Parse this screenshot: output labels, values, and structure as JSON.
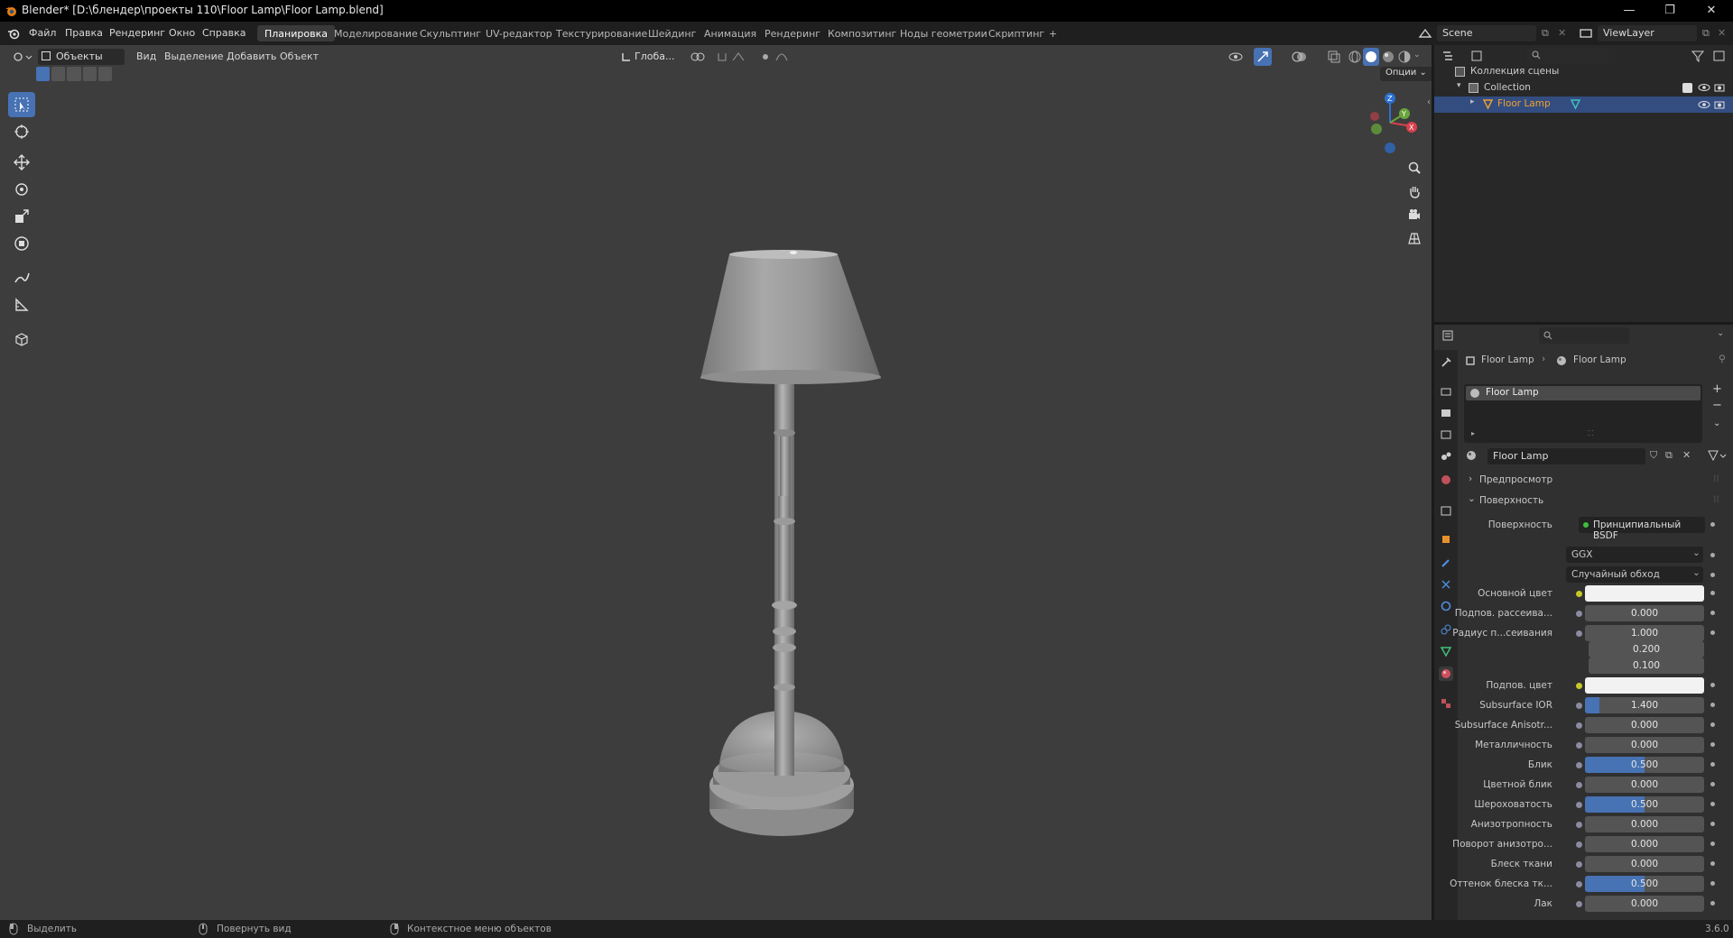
{
  "title": "Blender* [D:\\блендер\\проекты 110\\Floor Lamp\\Floor Lamp.blend]",
  "menu": [
    "Файл",
    "Правка",
    "Рендеринг",
    "Окно",
    "Справка"
  ],
  "workspaces": [
    "Планировка",
    "Моделирование",
    "Скульптинг",
    "UV-редактор",
    "Текстурирование",
    "Шейдинг",
    "Анимация",
    "Рендеринг",
    "Композитинг",
    "Ноды геометрии",
    "Скриптинг",
    "+"
  ],
  "scene": "Scene",
  "view_layer": "ViewLayer",
  "viewport": {
    "mode": "Объекты",
    "menus": [
      "Вид",
      "Выделение",
      "Добавить",
      "Объект"
    ],
    "transform_orientation": "Глоба...",
    "options": "Опции"
  },
  "outliner": {
    "root": "Коллекция сцены",
    "collection": "Collection",
    "object": "Floor Lamp"
  },
  "properties": {
    "breadcrumb_object": "Floor Lamp",
    "breadcrumb_material": "Floor Lamp",
    "slot": "Floor Lamp",
    "material_name": "Floor Lamp",
    "panel_preview": "Предпросмотр",
    "panel_surface": "Поверхность",
    "surface_label": "Поверхность",
    "surface_value": "Принципиальный BSDF",
    "distribution": "GGX",
    "subsurface_method": "Случайный обход",
    "rows": [
      {
        "label": "Основной цвет",
        "type": "color",
        "color": "#f2f2f2"
      },
      {
        "label": "Подпов. рассеива...",
        "value": "0.000",
        "fill": 0
      },
      {
        "label": "Радиус п...сеивания",
        "value": "1.000",
        "fill": 0
      },
      {
        "label": "",
        "value": "0.200",
        "fill": 0
      },
      {
        "label": "",
        "value": "0.100",
        "fill": 0
      },
      {
        "label": "Подпов. цвет",
        "type": "color",
        "color": "#f2f2f2"
      },
      {
        "label": "Subsurface IOR",
        "value": "1.400",
        "fill": 0.12
      },
      {
        "label": "Subsurface Anisotr...",
        "value": "0.000",
        "fill": 0
      },
      {
        "label": "Металличность",
        "value": "0.000",
        "fill": 0
      },
      {
        "label": "Блик",
        "value": "0.500",
        "fill": 0.5
      },
      {
        "label": "Цветной блик",
        "value": "0.000",
        "fill": 0
      },
      {
        "label": "Шероховатость",
        "value": "0.500",
        "fill": 0.5
      },
      {
        "label": "Анизотропность",
        "value": "0.000",
        "fill": 0
      },
      {
        "label": "Поворот анизотро...",
        "value": "0.000",
        "fill": 0
      },
      {
        "label": "Блеск ткани",
        "value": "0.000",
        "fill": 0
      },
      {
        "label": "Оттенок блеска тк...",
        "value": "0.500",
        "fill": 0.5
      },
      {
        "label": "Лак",
        "value": "0.000",
        "fill": 0
      }
    ]
  },
  "status": {
    "select": "Выделить",
    "rotate": "Повернуть вид",
    "context": "Контекстное меню объектов",
    "version": "3.6.0"
  },
  "colors": {
    "accent": "#4772b3",
    "selected_object": "#f0a030"
  }
}
